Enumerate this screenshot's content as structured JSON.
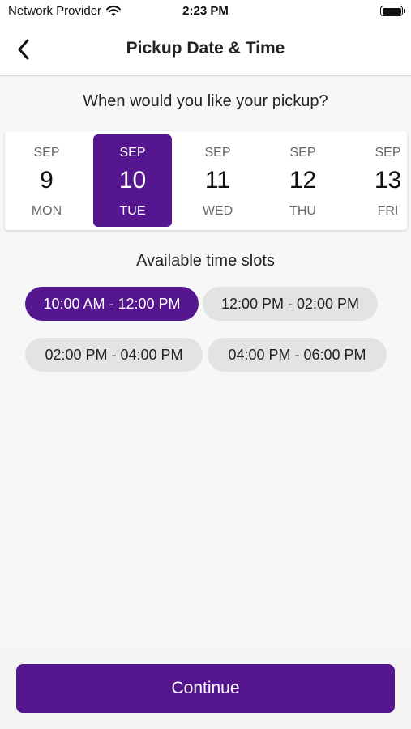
{
  "status_bar": {
    "carrier": "Network Provider",
    "time": "2:23 PM"
  },
  "header": {
    "title": "Pickup Date & Time",
    "back_icon": "chevron-left-icon"
  },
  "question": "When would you like your pickup?",
  "dates": [
    {
      "month": "SEP",
      "day": "9",
      "weekday": "MON",
      "selected": false
    },
    {
      "month": "SEP",
      "day": "10",
      "weekday": "TUE",
      "selected": true
    },
    {
      "month": "SEP",
      "day": "11",
      "weekday": "WED",
      "selected": false
    },
    {
      "month": "SEP",
      "day": "12",
      "weekday": "THU",
      "selected": false
    },
    {
      "month": "SEP",
      "day": "13",
      "weekday": "FRI",
      "selected": false
    }
  ],
  "slots_heading": "Available time slots",
  "slots": [
    {
      "label": "10:00 AM - 12:00 PM",
      "selected": true
    },
    {
      "label": "12:00 PM - 02:00 PM",
      "selected": false
    },
    {
      "label": "02:00 PM - 04:00 PM",
      "selected": false
    },
    {
      "label": "04:00 PM - 06:00 PM",
      "selected": false
    }
  ],
  "continue_label": "Continue",
  "colors": {
    "accent": "#55168f",
    "slot_bg": "#e3e3e3",
    "background": "#f7f7f7"
  }
}
